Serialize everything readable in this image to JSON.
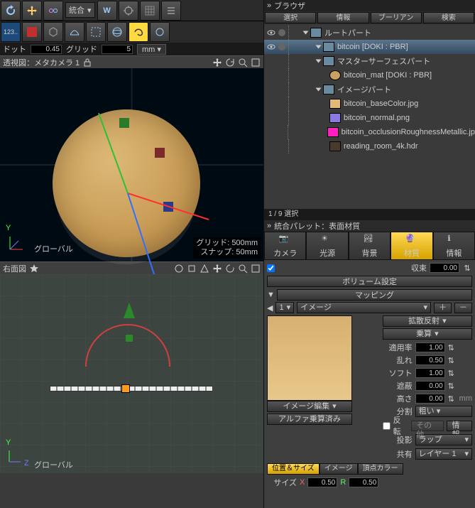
{
  "toolbar": {
    "label": "統合"
  },
  "status": {
    "dot": "ドット",
    "dot_val": "0.45",
    "grid": "グリッド",
    "grid_val": "5",
    "unit": "mm"
  },
  "viewport1": {
    "title": "透視図：メタカメラ 1",
    "global": "グローバル",
    "grid_info": "グリッド: 500mm",
    "snap_info": "スナップ: 50mm"
  },
  "viewport2": {
    "title": "右面図",
    "global": "グローバル"
  },
  "browser": {
    "title": "ブラウザ",
    "tabs": [
      "選択",
      "情報",
      "ブーリアン",
      "検索"
    ],
    "count": "1 / 9 選択",
    "tree": [
      {
        "indent": 0,
        "icon": "#6a8aa0",
        "label": "ルートパート"
      },
      {
        "indent": 1,
        "icon": "#6a8aa0",
        "label": "bitcoin [DOKI : PBR]",
        "sel": true
      },
      {
        "indent": 1,
        "icon": "#6a8aa0",
        "label": "マスターサーフェスパート"
      },
      {
        "indent": 2,
        "icon": "#caa060",
        "label": "bitcoin_mat [DOKI : PBR]",
        "round": true
      },
      {
        "indent": 1,
        "icon": "#6a8aa0",
        "label": "イメージパート"
      },
      {
        "indent": 2,
        "icon": "#e2b878",
        "label": "bitcoin_baseColor.jpg"
      },
      {
        "indent": 2,
        "icon": "#8a7ae2",
        "label": "bitcoin_normal.png"
      },
      {
        "indent": 2,
        "icon": "#ff20c0",
        "label": "bitcoin_occlusionRoughnessMetallic.jp"
      },
      {
        "indent": 2,
        "icon": "#4a3a2a",
        "label": "reading_room_4k.hdr"
      }
    ]
  },
  "palette": {
    "title": "統合パレット：表面材質",
    "big_tabs": [
      "カメラ",
      "光源",
      "背景",
      "材質",
      "情報"
    ],
    "active_big": 3,
    "shrink": "収束",
    "shrink_val": "0.00",
    "volume": "ボリューム設定",
    "mapping": "マッピング",
    "map_num": "1",
    "map_type": "イメージ",
    "image_edit": "イメージ編集",
    "alpha": "アルファ乗算済み",
    "diffuse": "拡散反射",
    "mult": "乗算",
    "rows": [
      {
        "l": "適用率",
        "v": "1.00"
      },
      {
        "l": "乱れ",
        "v": "0.50"
      },
      {
        "l": "ソフト",
        "v": "1.00"
      },
      {
        "l": "遮蔽",
        "v": "0.00"
      },
      {
        "l": "高さ",
        "v": "0.00",
        "u": "mm"
      },
      {
        "l": "分割",
        "v": "粗い",
        "dd": true
      }
    ],
    "reverse": "反転",
    "other": "その他",
    "info": "情報",
    "proj": "投影",
    "proj_v": "ラップ",
    "share": "共有",
    "share_v": "レイヤー 1",
    "pos_size": "位置＆サイズ",
    "sub_image": "イメージ",
    "sub_vcolor": "頂点カラー",
    "size": "サイズ",
    "sx": "0.50",
    "sy": "0.50"
  }
}
